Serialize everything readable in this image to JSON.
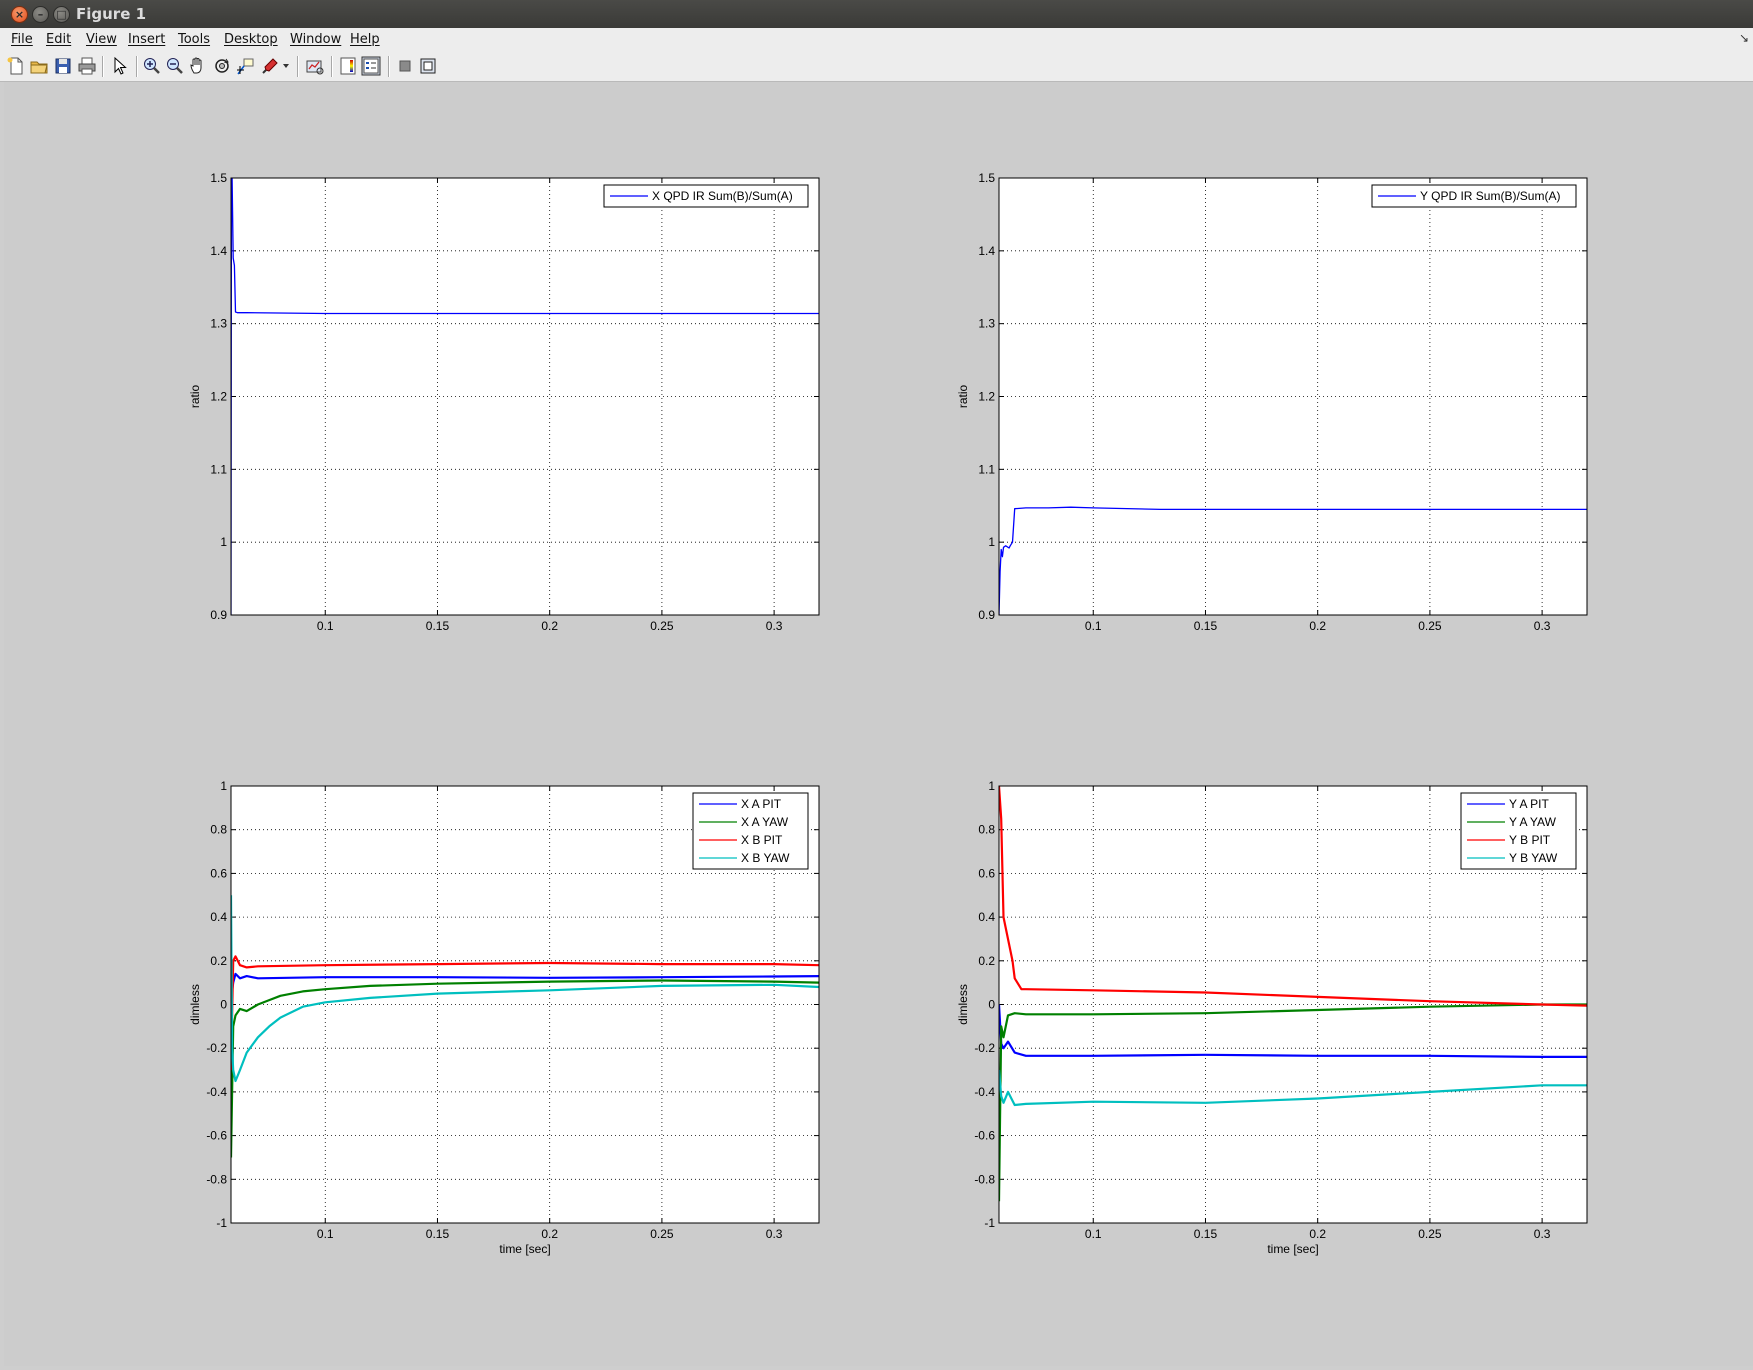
{
  "window": {
    "title": "Figure 1"
  },
  "menu": [
    "File",
    "Edit",
    "View",
    "Insert",
    "Tools",
    "Desktop",
    "Window",
    "Help"
  ],
  "toolbar_icons": [
    "new-figure-icon",
    "open-file-icon",
    "save-icon",
    "print-icon",
    "edit-plot-arrow-icon",
    "zoom-in-icon",
    "zoom-out-icon",
    "pan-hand-icon",
    "rotate-3d-icon",
    "data-cursor-icon",
    "brush-icon",
    "brush-dropdown-icon",
    "link-plot-icon",
    "insert-colorbar-icon",
    "insert-legend-icon",
    "hide-plot-tools-icon",
    "show-plot-tools-icon"
  ],
  "chart_data": [
    {
      "type": "line",
      "xlabel": "",
      "ylabel": "ratio",
      "xlim": [
        0.058,
        0.32
      ],
      "ylim": [
        0.9,
        1.5
      ],
      "xticks": [
        0.1,
        0.15,
        0.2,
        0.25,
        0.3
      ],
      "xtick_labels": [
        "0.1",
        "0.15",
        "0.2",
        "0.25",
        "0.3"
      ],
      "yticks": [
        0.9,
        1.0,
        1.1,
        1.2,
        1.3,
        1.4,
        1.5
      ],
      "ytick_labels": [
        "0.9",
        "1",
        "1.1",
        "1.2",
        "1.3",
        "1.4",
        "1.5"
      ],
      "grid": true,
      "legend_position": "top-right",
      "series": [
        {
          "name": "X QPD IR Sum(B)/Sum(A)",
          "color": "#0000ff",
          "x": [
            0.058,
            0.0582,
            0.0585,
            0.059,
            0.0595,
            0.06,
            0.061,
            0.065,
            0.1,
            0.15,
            0.2,
            0.25,
            0.3,
            0.32
          ],
          "y": [
            0.9,
            1.45,
            1.5,
            1.39,
            1.38,
            1.316,
            1.315,
            1.315,
            1.314,
            1.314,
            1.314,
            1.314,
            1.314,
            1.314
          ]
        }
      ]
    },
    {
      "type": "line",
      "xlabel": "",
      "ylabel": "ratio",
      "xlim": [
        0.058,
        0.32
      ],
      "ylim": [
        0.9,
        1.5
      ],
      "xticks": [
        0.1,
        0.15,
        0.2,
        0.25,
        0.3
      ],
      "xtick_labels": [
        "0.1",
        "0.15",
        "0.2",
        "0.25",
        "0.3"
      ],
      "yticks": [
        0.9,
        1.0,
        1.1,
        1.2,
        1.3,
        1.4,
        1.5
      ],
      "ytick_labels": [
        "0.9",
        "1",
        "1.1",
        "1.2",
        "1.3",
        "1.4",
        "1.5"
      ],
      "grid": true,
      "legend_position": "top-right",
      "series": [
        {
          "name": "Y QPD IR Sum(B)/Sum(A)",
          "color": "#0000ff",
          "x": [
            0.058,
            0.0585,
            0.059,
            0.0595,
            0.06,
            0.061,
            0.0625,
            0.063,
            0.064,
            0.065,
            0.07,
            0.08,
            0.09,
            0.1,
            0.13,
            0.15,
            0.2,
            0.25,
            0.3,
            0.32
          ],
          "y": [
            0.9,
            0.96,
            0.99,
            0.98,
            0.993,
            0.995,
            0.992,
            0.995,
            1.0,
            1.046,
            1.047,
            1.047,
            1.048,
            1.047,
            1.045,
            1.045,
            1.045,
            1.045,
            1.045,
            1.045
          ]
        }
      ]
    },
    {
      "type": "line",
      "xlabel": "time [sec]",
      "ylabel": "dimless",
      "xlim": [
        0.058,
        0.32
      ],
      "ylim": [
        -1,
        1
      ],
      "xticks": [
        0.1,
        0.15,
        0.2,
        0.25,
        0.3
      ],
      "xtick_labels": [
        "0.1",
        "0.15",
        "0.2",
        "0.25",
        "0.3"
      ],
      "yticks": [
        -1,
        -0.8,
        -0.6,
        -0.4,
        -0.2,
        0,
        0.2,
        0.4,
        0.6,
        0.8,
        1
      ],
      "ytick_labels": [
        "-1",
        "-0.8",
        "-0.6",
        "-0.4",
        "-0.2",
        "0",
        "0.2",
        "0.4",
        "0.6",
        "0.8",
        "1"
      ],
      "grid": true,
      "legend_position": "top-right",
      "series": [
        {
          "name": "X A PIT",
          "color": "#0000ff",
          "x": [
            0.058,
            0.059,
            0.06,
            0.062,
            0.065,
            0.07,
            0.1,
            0.15,
            0.2,
            0.25,
            0.3,
            0.32
          ],
          "y": [
            0.02,
            0.1,
            0.14,
            0.12,
            0.13,
            0.12,
            0.125,
            0.125,
            0.122,
            0.125,
            0.128,
            0.13
          ]
        },
        {
          "name": "X A YAW",
          "color": "#008000",
          "x": [
            0.058,
            0.059,
            0.06,
            0.062,
            0.065,
            0.07,
            0.075,
            0.08,
            0.09,
            0.1,
            0.12,
            0.15,
            0.2,
            0.25,
            0.3,
            0.32
          ],
          "y": [
            -0.7,
            -0.1,
            -0.05,
            -0.02,
            -0.03,
            0.0,
            0.02,
            0.04,
            0.06,
            0.07,
            0.085,
            0.095,
            0.105,
            0.11,
            0.105,
            0.1
          ]
        },
        {
          "name": "X B PIT",
          "color": "#ff0000",
          "x": [
            0.058,
            0.059,
            0.06,
            0.062,
            0.065,
            0.07,
            0.1,
            0.15,
            0.2,
            0.25,
            0.3,
            0.32
          ],
          "y": [
            -0.3,
            0.2,
            0.22,
            0.18,
            0.17,
            0.175,
            0.18,
            0.185,
            0.19,
            0.185,
            0.185,
            0.18
          ]
        },
        {
          "name": "X B YAW",
          "color": "#00bfbf",
          "x": [
            0.058,
            0.0585,
            0.059,
            0.06,
            0.062,
            0.065,
            0.07,
            0.075,
            0.08,
            0.09,
            0.1,
            0.12,
            0.15,
            0.2,
            0.25,
            0.3,
            0.32
          ],
          "y": [
            0.5,
            -0.2,
            -0.3,
            -0.35,
            -0.3,
            -0.22,
            -0.15,
            -0.1,
            -0.06,
            -0.01,
            0.01,
            0.03,
            0.05,
            0.065,
            0.085,
            0.09,
            0.08
          ]
        }
      ]
    },
    {
      "type": "line",
      "xlabel": "time [sec]",
      "ylabel": "dimless",
      "xlim": [
        0.058,
        0.32
      ],
      "ylim": [
        -1,
        1
      ],
      "xticks": [
        0.1,
        0.15,
        0.2,
        0.25,
        0.3
      ],
      "xtick_labels": [
        "0.1",
        "0.15",
        "0.2",
        "0.25",
        "0.3"
      ],
      "yticks": [
        -1,
        -0.8,
        -0.6,
        -0.4,
        -0.2,
        0,
        0.2,
        0.4,
        0.6,
        0.8,
        1
      ],
      "ytick_labels": [
        "-1",
        "-0.8",
        "-0.6",
        "-0.4",
        "-0.2",
        "0",
        "0.2",
        "0.4",
        "0.6",
        "0.8",
        "1"
      ],
      "grid": true,
      "legend_position": "top-right",
      "series": [
        {
          "name": "Y A PIT",
          "color": "#0000ff",
          "x": [
            0.058,
            0.059,
            0.06,
            0.062,
            0.065,
            0.07,
            0.1,
            0.15,
            0.2,
            0.25,
            0.3,
            0.32
          ],
          "y": [
            0.0,
            -0.18,
            -0.2,
            -0.17,
            -0.22,
            -0.235,
            -0.235,
            -0.23,
            -0.235,
            -0.235,
            -0.24,
            -0.24
          ]
        },
        {
          "name": "Y A YAW",
          "color": "#008000",
          "x": [
            0.058,
            0.059,
            0.06,
            0.062,
            0.065,
            0.07,
            0.1,
            0.15,
            0.2,
            0.25,
            0.3,
            0.32
          ],
          "y": [
            -0.9,
            -0.1,
            -0.15,
            -0.05,
            -0.04,
            -0.045,
            -0.045,
            -0.04,
            -0.025,
            -0.01,
            0.0,
            0.0
          ]
        },
        {
          "name": "Y B PIT",
          "color": "#ff0000",
          "x": [
            0.058,
            0.059,
            0.06,
            0.062,
            0.064,
            0.065,
            0.068,
            0.07,
            0.1,
            0.15,
            0.2,
            0.25,
            0.3,
            0.32
          ],
          "y": [
            1.0,
            0.85,
            0.4,
            0.3,
            0.2,
            0.12,
            0.07,
            0.07,
            0.065,
            0.055,
            0.035,
            0.015,
            0.0,
            -0.005
          ]
        },
        {
          "name": "Y B YAW",
          "color": "#00bfbf",
          "x": [
            0.058,
            0.059,
            0.06,
            0.062,
            0.065,
            0.07,
            0.1,
            0.15,
            0.2,
            0.25,
            0.3,
            0.32
          ],
          "y": [
            -0.3,
            -0.42,
            -0.45,
            -0.4,
            -0.46,
            -0.455,
            -0.445,
            -0.45,
            -0.43,
            -0.4,
            -0.37,
            -0.37
          ]
        }
      ]
    }
  ]
}
